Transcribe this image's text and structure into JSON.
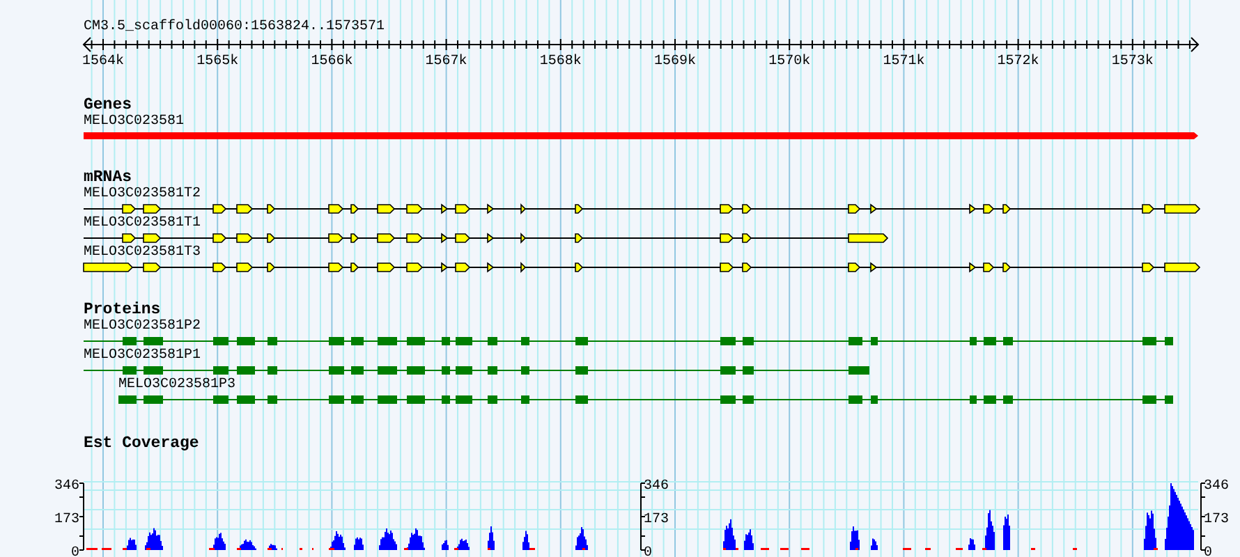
{
  "ruler": {
    "title": "CM3.5_scaffold00060:1563824..1573571",
    "tick_labels": [
      "1564k",
      "1565k",
      "1566k",
      "1567k",
      "1568k",
      "1569k",
      "1570k",
      "1571k",
      "1572k",
      "1573k"
    ]
  },
  "tracks": [
    {
      "kind": "gene",
      "title": "Genes",
      "features": [
        {
          "name": "MELO3C023581"
        }
      ]
    },
    {
      "kind": "mrna",
      "title": "mRNAs",
      "features": [
        {
          "name": "MELO3C023581T2"
        },
        {
          "name": "MELO3C023581T1"
        },
        {
          "name": "MELO3C023581T3"
        }
      ]
    },
    {
      "kind": "protein",
      "title": "Proteins",
      "features": [
        {
          "name": "MELO3C023581P2"
        },
        {
          "name": "MELO3C023581P1"
        },
        {
          "name": "MELO3C023581P3"
        }
      ]
    },
    {
      "kind": "coverage",
      "title": "Est Coverage",
      "axes": [
        {
          "labels": [
            "346",
            "173",
            "0"
          ]
        },
        {
          "labels": [
            "346",
            "173",
            "0"
          ]
        },
        {
          "labels": [
            "346",
            "173",
            "0"
          ]
        }
      ]
    }
  ]
}
